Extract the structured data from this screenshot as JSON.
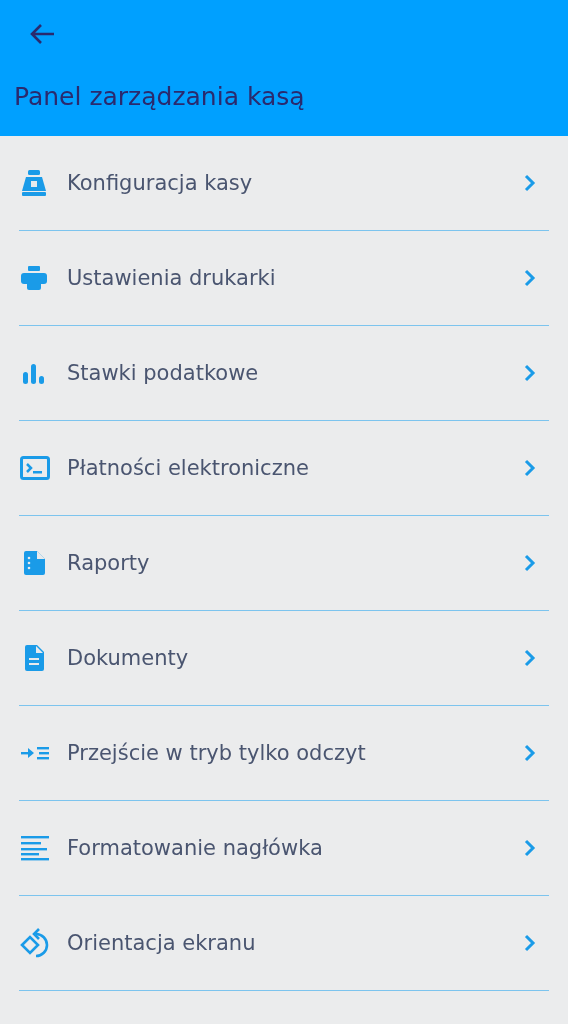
{
  "header": {
    "title": "Panel zarządzania kasą"
  },
  "items": [
    {
      "label": "Konfiguracja kasy"
    },
    {
      "label": "Ustawienia drukarki"
    },
    {
      "label": "Stawki podatkowe"
    },
    {
      "label": "Płatności elektroniczne"
    },
    {
      "label": "Raporty"
    },
    {
      "label": "Dokumenty"
    },
    {
      "label": "Przejście w tryb tylko odczyt"
    },
    {
      "label": "Formatowanie nagłówka"
    },
    {
      "label": "Orientacja ekranu"
    }
  ]
}
